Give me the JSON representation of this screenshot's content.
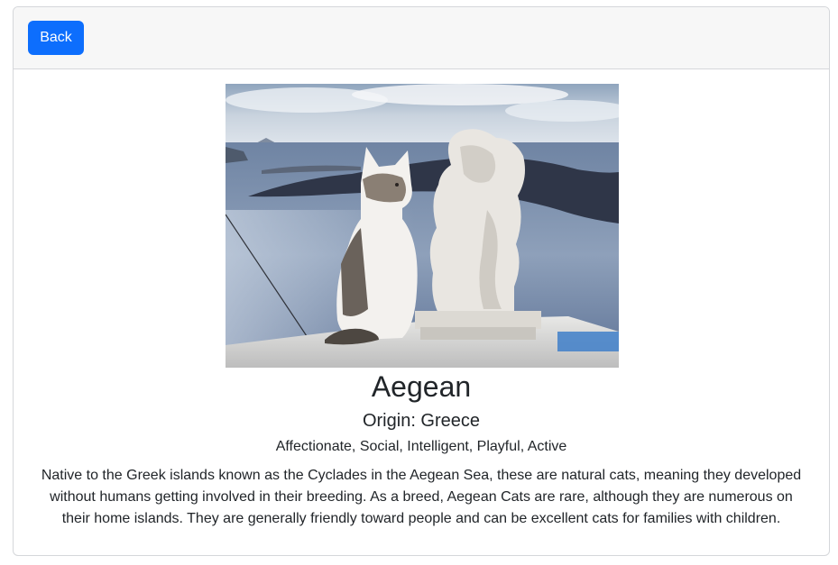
{
  "header": {
    "back_label": "Back"
  },
  "breed": {
    "name": "Aegean",
    "origin": "Origin: Greece",
    "temperament": "Affectionate, Social, Intelligent, Playful, Active",
    "description": "Native to the Greek islands known as the Cyclades in the Aegean Sea, these are natural cats, meaning they developed without humans getting involved in their breeding. As a breed, Aegean Cats are rare, although they are numerous on their home islands. They are generally friendly toward people and can be excellent cats for families with children."
  },
  "colors": {
    "primary": "#0d6efd",
    "header_bg": "#f7f7f7",
    "border": "#d5d7da",
    "text": "#212529"
  }
}
